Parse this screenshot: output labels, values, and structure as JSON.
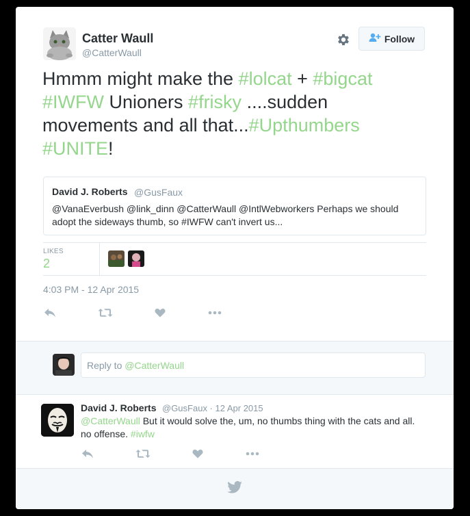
{
  "author": {
    "name": "Catter Waull",
    "handle": "@CatterWaull",
    "follow_label": "Follow"
  },
  "tweet": {
    "parts": [
      {
        "text": "Hmmm might make the ",
        "tag": false
      },
      {
        "text": "#lolcat",
        "tag": true
      },
      {
        "text": " + ",
        "tag": false
      },
      {
        "text": "#bigcat",
        "tag": true
      },
      {
        "text": " ",
        "tag": false
      },
      {
        "text": "#IWFW",
        "tag": true
      },
      {
        "text": " Unioners ",
        "tag": false
      },
      {
        "text": "#frisky",
        "tag": true
      },
      {
        "text": " ....sudden movements and all that...",
        "tag": false
      },
      {
        "text": "#Upthumbers",
        "tag": true
      },
      {
        "text": " ",
        "tag": false
      },
      {
        "text": "#UNITE",
        "tag": true
      },
      {
        "text": "!",
        "tag": false
      }
    ]
  },
  "quote": {
    "name": "David J. Roberts",
    "handle": "@GusFaux",
    "text": "@VanaEverbush @link_dinn @CatterWaull @IntlWebworkers Perhaps we should adopt the sideways thumb, so #IWFW can't invert us..."
  },
  "stats": {
    "likes_label": "LIKES",
    "likes_count": "2"
  },
  "timestamp": "4:03 PM - 12 Apr 2015",
  "reply_box": {
    "prefix": "Reply to ",
    "mention": "@CatterWaull"
  },
  "reply": {
    "name": "David J. Roberts",
    "meta": "@GusFaux · 12 Apr 2015",
    "parts": [
      {
        "text": "@CatterWaull",
        "tag": true
      },
      {
        "text": " But it would solve the, um, no thumbs thing with the cats and all. no offense. ",
        "tag": false
      },
      {
        "text": "#iwfw",
        "tag": true
      }
    ]
  },
  "icons": {
    "reply": "reply-icon",
    "retweet": "retweet-icon",
    "like": "heart-icon",
    "more": "more-icon",
    "gear": "gear-icon",
    "bird": "twitter-bird-icon"
  },
  "colors": {
    "link": "#94d68b",
    "text": "#292f33",
    "muted": "#8899a6",
    "icon": "#aab8c2",
    "border": "#e1e8ed"
  }
}
